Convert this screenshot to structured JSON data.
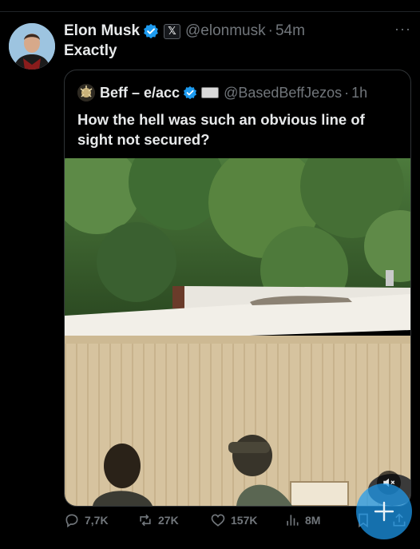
{
  "post": {
    "author_name": "Elon Musk",
    "x_badge": "𝕏",
    "handle": "@elonmusk",
    "separator": "·",
    "time": "54m",
    "text": "Exactly",
    "more": "···"
  },
  "quote": {
    "author_name": "Beff – e/acc",
    "handle": "@BasedBeffJezos",
    "separator": "·",
    "time": "1h",
    "text": "How the hell was such an obvious line of sight not secured?"
  },
  "actions": {
    "replies": "7,7K",
    "reposts": "27K",
    "likes": "157K",
    "views": "8M"
  },
  "colors": {
    "background": "#000000",
    "accent": "#1d9bf0",
    "muted": "#71767b",
    "text": "#e7e9ea"
  },
  "icons": [
    "verified-badge-icon",
    "x-affiliate-icon",
    "more-icon",
    "reply-icon",
    "repost-icon",
    "like-icon",
    "views-icon",
    "bookmark-icon",
    "share-icon",
    "mute-icon",
    "compose-plus-icon"
  ]
}
